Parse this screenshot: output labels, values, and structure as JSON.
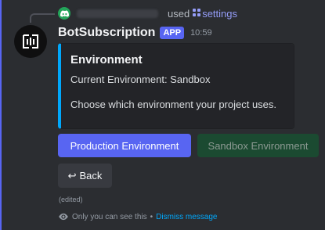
{
  "reply": {
    "used_text": "used",
    "command": "settings",
    "command_icon": "slash-command-icon"
  },
  "bot": {
    "name": "BotSubscription",
    "badge": "APP",
    "time": "10:59"
  },
  "embed": {
    "title": "Environment",
    "line1": "Current Environment: Sandbox",
    "line2": "Choose which environment your project uses.",
    "accent_color": "#00a8fc"
  },
  "buttons": {
    "production": "Production Environment",
    "sandbox": "Sandbox Environment",
    "back_label": "Back",
    "back_icon": "↩"
  },
  "footer": {
    "edited": "(edited)",
    "visibility": "Only you can see this",
    "separator": "•",
    "dismiss": "Dismiss message"
  },
  "colors": {
    "blurple": "#5865f2",
    "success": "#1b4a31",
    "link": "#00a8fc"
  }
}
